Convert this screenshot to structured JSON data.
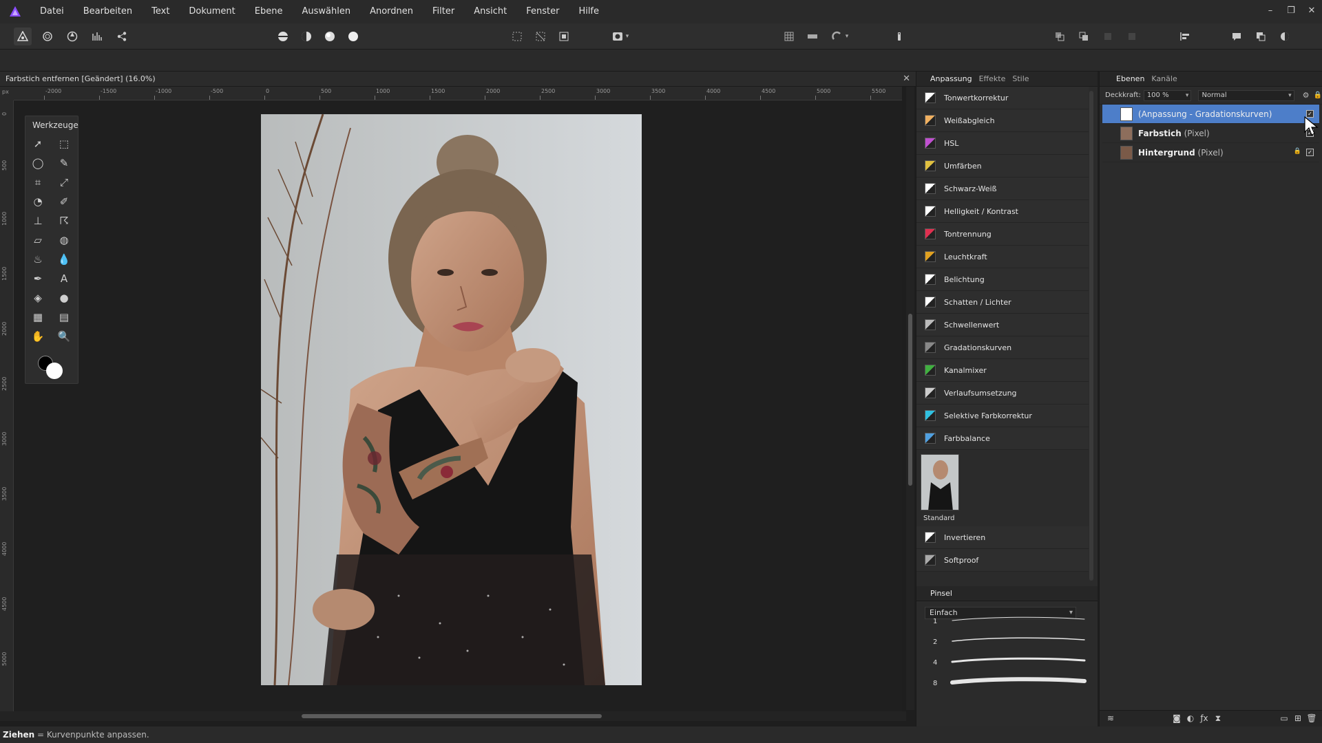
{
  "menu": [
    "Datei",
    "Bearbeiten",
    "Text",
    "Dokument",
    "Ebene",
    "Auswählen",
    "Anordnen",
    "Filter",
    "Ansicht",
    "Fenster",
    "Hilfe"
  ],
  "window_controls": [
    "–",
    "❐",
    "✕"
  ],
  "document": {
    "title": "Farbstich entfernen [Geändert] (16.0%)",
    "close": "✕",
    "ruler_unit": "px",
    "ruler_h": [
      "-2000",
      "-1500",
      "-1000",
      "-500",
      "0",
      "500",
      "1000",
      "1500",
      "2000",
      "2500",
      "3000",
      "3500",
      "4000",
      "4500",
      "5000",
      "5500"
    ],
    "ruler_v": [
      "0",
      "500",
      "1000",
      "1500",
      "2000",
      "2500",
      "3000",
      "3500",
      "4000",
      "4500",
      "5000"
    ]
  },
  "tools_panel": {
    "title": "Werkzeuge"
  },
  "adjustment_panel": {
    "tabs": [
      "Anpassung",
      "Effekte",
      "Stile"
    ],
    "items": [
      {
        "label": "Tonwertkorrektur",
        "icon": "levels-icon",
        "color": "#ffffff"
      },
      {
        "label": "Weißabgleich",
        "icon": "white-balance-icon",
        "color": "#f0b060"
      },
      {
        "label": "HSL",
        "icon": "hsl-icon",
        "color": "#c050d0"
      },
      {
        "label": "Umfärben",
        "icon": "recolor-icon",
        "color": "#e0c040"
      },
      {
        "label": "Schwarz-Weiß",
        "icon": "black-white-icon",
        "color": "#ffffff"
      },
      {
        "label": "Helligkeit / Kontrast",
        "icon": "brightness-contrast-icon",
        "color": "#ffffff"
      },
      {
        "label": "Tontrennung",
        "icon": "posterize-icon",
        "color": "#e03050"
      },
      {
        "label": "Leuchtkraft",
        "icon": "vibrance-icon",
        "color": "#e0a020"
      },
      {
        "label": "Belichtung",
        "icon": "exposure-icon",
        "color": "#ffffff"
      },
      {
        "label": "Schatten / Lichter",
        "icon": "shadows-highlights-icon",
        "color": "#ffffff"
      },
      {
        "label": "Schwellenwert",
        "icon": "threshold-icon",
        "color": "#bbbbbb"
      },
      {
        "label": "Gradationskurven",
        "icon": "curves-icon",
        "color": "#888888"
      },
      {
        "label": "Kanalmixer",
        "icon": "channel-mixer-icon",
        "color": "#40b040"
      },
      {
        "label": "Verlaufsumsetzung",
        "icon": "gradient-map-icon",
        "color": "#cccccc"
      },
      {
        "label": "Selektive Farbkorrektur",
        "icon": "selective-color-icon",
        "color": "#30c0e0"
      },
      {
        "label": "Farbbalance",
        "icon": "color-balance-icon",
        "color": "#50a0e0"
      }
    ],
    "preset_label": "Standard",
    "items_after": [
      {
        "label": "Invertieren",
        "icon": "invert-icon",
        "color": "#ffffff"
      },
      {
        "label": "Softproof",
        "icon": "softproof-icon",
        "color": "#aaaaaa"
      }
    ]
  },
  "brush_panel": {
    "tab": "Pinsel",
    "category": "Einfach",
    "sizes": [
      "1",
      "2",
      "4",
      "8"
    ]
  },
  "layers_panel": {
    "tabs": [
      "Ebenen",
      "Kanäle"
    ],
    "opacity_label": "Deckkraft:",
    "opacity_value": "100 %",
    "blend_mode": "Normal",
    "layers": [
      {
        "name": "(Anpassung - Gradationskurven)",
        "type": "",
        "selected": true
      },
      {
        "name": "Farbstich",
        "type": "(Pixel)",
        "selected": false
      },
      {
        "name": "Hintergrund",
        "type": "(Pixel)",
        "selected": false
      }
    ]
  },
  "status": {
    "bold": "Ziehen",
    "text": " = Kurvenpunkte anpassen."
  },
  "colors": {
    "accent": "#4d7ec9",
    "brand": "#8a4cff"
  }
}
